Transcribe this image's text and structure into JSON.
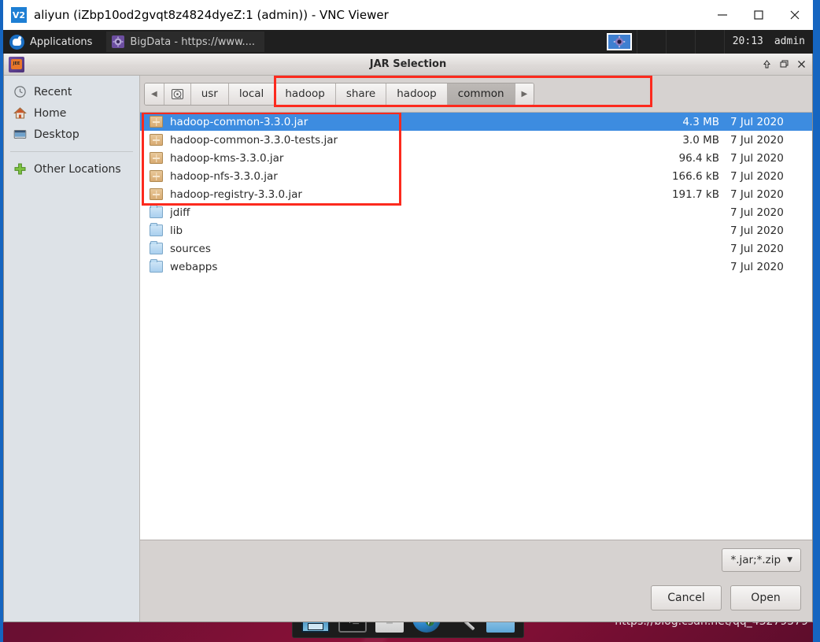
{
  "vnc_window": {
    "title": "aliyun (iZbp10od2gvqt8z4824dyeZ:1 (admin)) - VNC Viewer",
    "logo_text": "V2",
    "minimize_label": "—",
    "maximize_label": "□",
    "close_label": "✕"
  },
  "top_panel": {
    "applications_label": "Applications",
    "applications_icon": "hand-icon",
    "task_label": "BigData - https://www....",
    "task_icon": "gear-icon",
    "tray_icon": "gear-icon",
    "clock": "20:13",
    "user": "admin"
  },
  "dialog": {
    "title": "JAR Selection",
    "icon": "java-ee-icon",
    "window_buttons": {
      "shade": "⬆",
      "restore": "❐",
      "close": "✕"
    },
    "sidebar": {
      "items": [
        {
          "label": "Recent",
          "icon": "clock-icon"
        },
        {
          "label": "Home",
          "icon": "home-icon"
        },
        {
          "label": "Desktop",
          "icon": "desktop-icon"
        },
        {
          "label": "Other Locations",
          "icon": "plus-icon"
        }
      ]
    },
    "pathbar": {
      "back_icon": "◀",
      "forward_icon": "▶",
      "drive_icon": "hard-drive-icon",
      "crumbs": [
        {
          "label": "usr",
          "active": false
        },
        {
          "label": "local",
          "active": false
        },
        {
          "label": "hadoop",
          "active": false
        },
        {
          "label": "share",
          "active": false
        },
        {
          "label": "hadoop",
          "active": false
        },
        {
          "label": "common",
          "active": true
        }
      ]
    },
    "files": [
      {
        "name": "hadoop-common-3.3.0.jar",
        "size": "4.3 MB",
        "date": "7 Jul 2020",
        "type": "jar",
        "selected": true
      },
      {
        "name": "hadoop-common-3.3.0-tests.jar",
        "size": "3.0 MB",
        "date": "7 Jul 2020",
        "type": "jar",
        "selected": false
      },
      {
        "name": "hadoop-kms-3.3.0.jar",
        "size": "96.4 kB",
        "date": "7 Jul 2020",
        "type": "jar",
        "selected": false
      },
      {
        "name": "hadoop-nfs-3.3.0.jar",
        "size": "166.6 kB",
        "date": "7 Jul 2020",
        "type": "jar",
        "selected": false
      },
      {
        "name": "hadoop-registry-3.3.0.jar",
        "size": "191.7 kB",
        "date": "7 Jul 2020",
        "type": "jar",
        "selected": false
      },
      {
        "name": "jdiff",
        "size": "",
        "date": "7 Jul 2020",
        "type": "folder",
        "selected": false
      },
      {
        "name": "lib",
        "size": "",
        "date": "7 Jul 2020",
        "type": "folder",
        "selected": false
      },
      {
        "name": "sources",
        "size": "",
        "date": "7 Jul 2020",
        "type": "folder",
        "selected": false
      },
      {
        "name": "webapps",
        "size": "",
        "date": "7 Jul 2020",
        "type": "folder",
        "selected": false
      }
    ],
    "filter": {
      "value": "*.jar;*.zip",
      "chevron": "▼"
    },
    "buttons": {
      "cancel": "Cancel",
      "open": "Open"
    }
  },
  "dock": {
    "items": [
      {
        "icon": "display-window-icon"
      },
      {
        "icon": "terminal-icon",
        "label": "$_"
      },
      {
        "icon": "home-folder-icon"
      },
      {
        "icon": "web-browser-globe-icon"
      },
      {
        "icon": "search-magnifier-icon"
      },
      {
        "icon": "file-manager-folder-icon"
      }
    ]
  },
  "watermark": "https://blog.csdn.net/qq_43279579",
  "colors": {
    "selection_blue": "#3d8ce0",
    "annotation_red": "#fc2a1e",
    "panel_dark": "#1f1f1f",
    "desktop_maroon": "#6b0f32",
    "vnc_frame_blue": "#1565c0"
  }
}
